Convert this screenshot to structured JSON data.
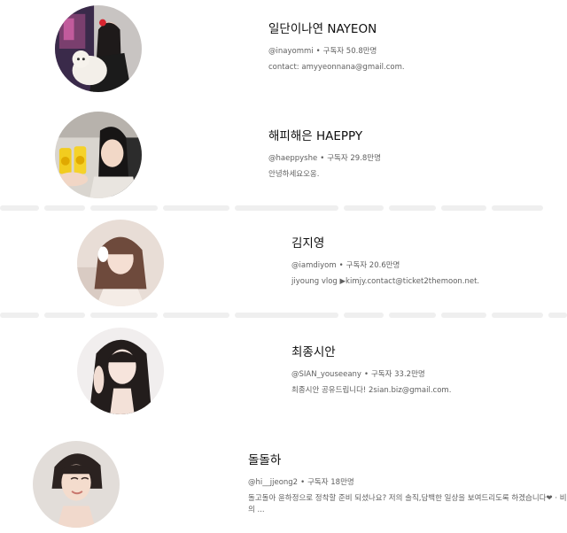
{
  "channels": [
    {
      "name": "일단이나연 NAYEON",
      "handle": "@inayommi",
      "dot": "•",
      "subscribers": "구독자 50.8만명",
      "description": "contact: amyyeonnana@gmail.com.",
      "avatar_icon": "avatar-photo"
    },
    {
      "name": "해피해은 HAEPPY",
      "handle": "@haeppyshe",
      "dot": "•",
      "subscribers": "구독자 29.8만명",
      "description": "안녕하세요오옹.",
      "avatar_icon": "avatar-photo"
    },
    {
      "name": "김지영",
      "handle": "@iamdiyom",
      "dot": "•",
      "subscribers": "구독자 20.6만명",
      "description": "jiyoung vlog ▶kimjy.contact@ticket2themoon.net.",
      "avatar_icon": "avatar-photo"
    },
    {
      "name": "최종시안",
      "handle": "@SIAN_youseeany",
      "dot": "•",
      "subscribers": "구독자 33.2만명",
      "description": "최종시안 공유드립니다! 2sian.biz@gmail.com.",
      "avatar_icon": "avatar-photo"
    },
    {
      "name": "돌돌하",
      "handle": "@hi__jjeong2",
      "dot": "•",
      "subscribers": "구독자 18만명",
      "description": "돌고돌아 윤하정으로 정착할 준비 되셨나요? 저의 솔직,담백한 일상을 보여드리도록 하겠습니다❤ · 비의 ...",
      "avatar_icon": "avatar-photo"
    }
  ],
  "colors": {
    "text_primary": "#0f0f0f",
    "text_secondary": "#606060",
    "separator": "#efefef"
  }
}
